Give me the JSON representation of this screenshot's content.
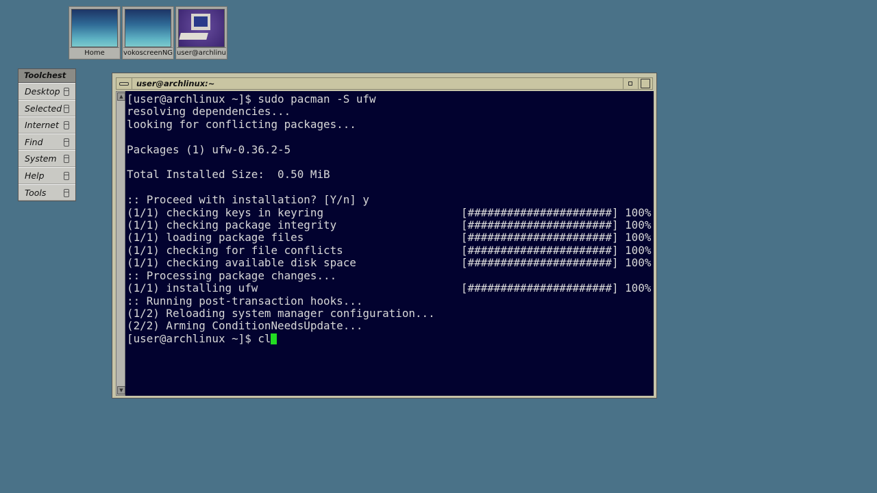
{
  "desktop_icons": [
    {
      "label": "Home",
      "kind": "folder"
    },
    {
      "label": "vokoscreenNG",
      "kind": "folder"
    },
    {
      "label": "user@archlinux:~",
      "kind": "terminal"
    }
  ],
  "toolchest": {
    "title": "Toolchest",
    "items": [
      "Desktop",
      "Selected",
      "Internet",
      "Find",
      "System",
      "Help",
      "Tools"
    ]
  },
  "window": {
    "title": "user@archlinux:~"
  },
  "terminal": {
    "lines": [
      {
        "text": "[user@archlinux ~]$ sudo pacman -S ufw"
      },
      {
        "text": "resolving dependencies..."
      },
      {
        "text": "looking for conflicting packages..."
      },
      {
        "text": ""
      },
      {
        "text": "Packages (1) ufw-0.36.2-5"
      },
      {
        "text": ""
      },
      {
        "text": "Total Installed Size:  0.50 MiB"
      },
      {
        "text": ""
      },
      {
        "text": ":: Proceed with installation? [Y/n] y"
      },
      {
        "text": "(1/1) checking keys in keyring",
        "progress": "[######################] 100%"
      },
      {
        "text": "(1/1) checking package integrity",
        "progress": "[######################] 100%"
      },
      {
        "text": "(1/1) loading package files",
        "progress": "[######################] 100%"
      },
      {
        "text": "(1/1) checking for file conflicts",
        "progress": "[######################] 100%"
      },
      {
        "text": "(1/1) checking available disk space",
        "progress": "[######################] 100%"
      },
      {
        "text": ":: Processing package changes..."
      },
      {
        "text": "(1/1) installing ufw",
        "progress": "[######################] 100%"
      },
      {
        "text": ":: Running post-transaction hooks..."
      },
      {
        "text": "(1/2) Reloading system manager configuration..."
      },
      {
        "text": "(2/2) Arming ConditionNeedsUpdate..."
      }
    ],
    "prompt": "[user@archlinux ~]$ cl",
    "cursor_color": "#22dd22"
  }
}
